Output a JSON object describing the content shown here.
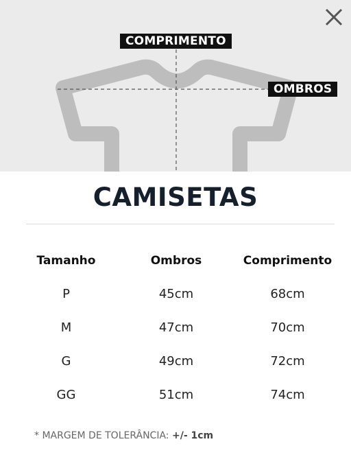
{
  "header": {
    "close_icon": "close-icon",
    "label_comprimento": "COMPRIMENTO",
    "label_ombros": "OMBROS"
  },
  "title": "CAMISETAS",
  "table": {
    "headers": [
      "Tamanho",
      "Ombros",
      "Comprimento"
    ],
    "rows": [
      [
        "P",
        "45cm",
        "68cm"
      ],
      [
        "M",
        "47cm",
        "70cm"
      ],
      [
        "G",
        "49cm",
        "72cm"
      ],
      [
        "GG",
        "51cm",
        "74cm"
      ]
    ]
  },
  "footnote": {
    "prefix": "* MARGEM DE TOLERÂNCIA:",
    "value": "+/- 1cm"
  },
  "colors": {
    "hero_background": "#ebebeb",
    "shirt_outline": "#bdbdbd",
    "title": "#16202c",
    "tag_background": "#111111"
  }
}
